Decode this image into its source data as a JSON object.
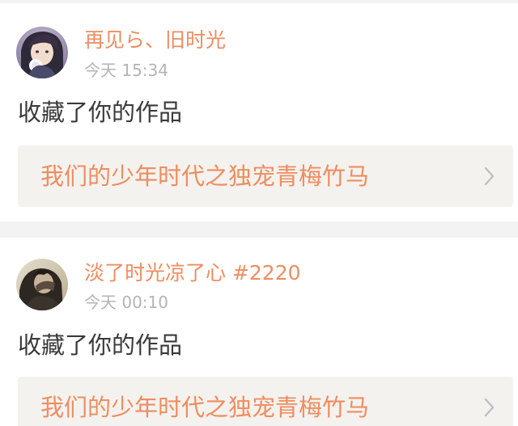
{
  "feed": {
    "items": [
      {
        "user_name": "再见ら、旧时光",
        "time": "今天 15:34",
        "action": "收藏了你的作品",
        "work_title": "我们的少年时代之独宠青梅竹马",
        "avatar_icon": "user-avatar-icon",
        "chevron_icon": "chevron-right-icon"
      },
      {
        "user_name": "淡了时光凉了心 #2220",
        "time": "今天 00:10",
        "action": "收藏了你的作品",
        "work_title": "我们的少年时代之独宠青梅竹马",
        "avatar_icon": "user-avatar-icon",
        "chevron_icon": "chevron-right-icon"
      }
    ]
  },
  "colors": {
    "accent": "#ee8d61",
    "timestamp": "#b4b4b4",
    "text": "#3a3a3a",
    "link_background": "#f4f2ee",
    "page_background": "#f3f3f3"
  }
}
